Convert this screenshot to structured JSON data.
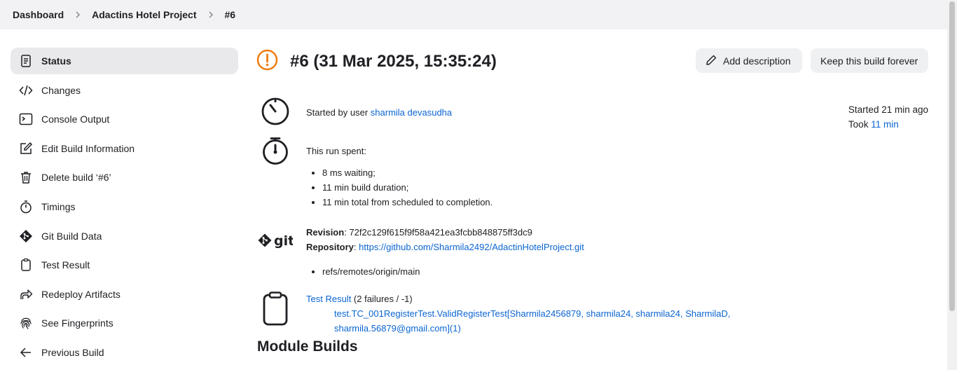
{
  "breadcrumb": [
    "Dashboard",
    "Adactins Hotel Project",
    "#6"
  ],
  "sidebar": {
    "items": [
      {
        "label": "Status",
        "icon": "document-icon"
      },
      {
        "label": "Changes",
        "icon": "code-icon"
      },
      {
        "label": "Console Output",
        "icon": "terminal-icon"
      },
      {
        "label": "Edit Build Information",
        "icon": "edit-icon"
      },
      {
        "label": "Delete build ‘#6’",
        "icon": "trash-icon"
      },
      {
        "label": "Timings",
        "icon": "stopwatch-icon"
      },
      {
        "label": "Git Build Data",
        "icon": "git-icon"
      },
      {
        "label": "Test Result",
        "icon": "clipboard-icon"
      },
      {
        "label": "Redeploy Artifacts",
        "icon": "redeploy-icon"
      },
      {
        "label": "See Fingerprints",
        "icon": "fingerprint-icon"
      },
      {
        "label": "Previous Build",
        "icon": "arrow-left-icon"
      }
    ]
  },
  "header": {
    "title": "#6 (31 Mar 2025, 15:35:24)",
    "add_description": "Add description",
    "keep_forever": "Keep this build forever",
    "status_color": "#f07c0f"
  },
  "started": {
    "prefix": "Started by user ",
    "user": "sharmila devasudha"
  },
  "meta": {
    "started": "Started 21 min ago",
    "took_prefix": "Took ",
    "took": "11 min"
  },
  "timing": {
    "heading": "This run spent:",
    "items": [
      "8 ms waiting;",
      "11 min build duration;",
      "11 min total from scheduled to completion."
    ]
  },
  "git": {
    "revision_label": "Revision",
    "revision": ": 72f2c129f615f9f58a421ea3fcbb848875ff3dc9",
    "repository_label": "Repository",
    "repository_sep": ": ",
    "repository": "https://github.com/Sharmila2492/AdactinHotelProject.git",
    "refs": [
      "refs/remotes/origin/main"
    ],
    "logo_text": "git"
  },
  "tests": {
    "link": "Test Result",
    "summary": " (2 failures / -1)",
    "failure_line1": "test.TC_001RegisterTest.ValidRegisterTest[Sharmila2456879, sharmila24, sharmila24, SharmilaD,",
    "failure_line2": "sharmila.56879@gmail.com](1)"
  },
  "module_builds": "Module Builds",
  "link_color": "#0b65d1"
}
